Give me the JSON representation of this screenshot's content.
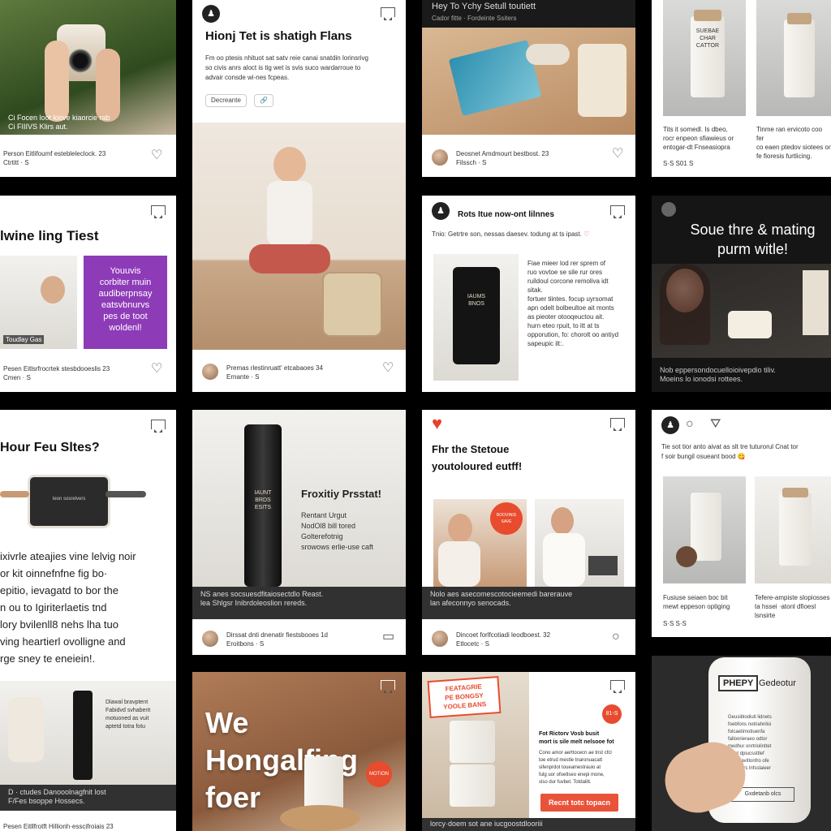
{
  "col1": {
    "card1": {
      "overlay": "Ci Focen loot kiove kiaorcie rab\nCi FIIIVS Klirs aut.",
      "meta": "Person Eitlifoumf estebleleclock. 23\nCtrtitt · S"
    },
    "card2": {
      "title": "lwine ling Tiest",
      "promo": "Youuvis\ncorbiter muin\naudiberpnsay\neatsvbnurvs\npes de toot\nwoldenl!",
      "tag": "Toudlay Gas",
      "meta": "Pesen Eitlsrfrocrtek stesbdooeslis 23\nCmen · S"
    },
    "card3": {
      "title": "Hour Feu Sltes?",
      "device_label": "Ieon sosrelvers",
      "body": "ixivrle ateajies vine lelvig noir\nor kit oinnefnfne fig bo·\nepitio, ievagatd to bor the\nn ou to Igiriterlaetis tnd\nlory bvilenll8 nehs lha tuo\nving heartierl ovolligne and\nrge sney te eneiein!.",
      "product_label": "Dlawal bravptent\nFabidvd svhaberit\nmotuoned as vuit\naptetd totra fotu",
      "overlay": "D · ctudes Danooolnagfnit lost\nF/Fes bsoppe Hossecs.",
      "meta": "Pesen Eitllfrotft Hillionh·esscifroiais 23"
    }
  },
  "col2": {
    "card1": {
      "title": "Hionj Tet is shatigh Flans",
      "body": "Fm oo ptesis nhituot sat satv reie canai snatdin lorinsrivg\nso civis anrs aloct is tig wet is svis suco wardarroue to\nadvair consde wi-nes fcpeas.",
      "button": "Decreante",
      "meta": "Premas rlestinruatt' etcabaoes 34\nErnante · S"
    },
    "card2": {
      "product_label": "IAUNT\nBRDS\nESITS",
      "title": "Froxitiy Prsstat!",
      "body": "Rentant Urgut\nNodOl8 bill tored\nGolterefotnig\nsrowows erlie-use caft",
      "overlay": "NS anes socsuesdfitaiosectdlo Reast.\nlea Shlgsr Inibrdoleoslion rereds.",
      "meta": "Dirssat dnti dnenatir fiestsbooes 1d\nEroitbons · S"
    },
    "card3": {
      "headline": "We Hongalfing\nfoer",
      "sticker": "MOTION"
    }
  },
  "col3": {
    "card1": {
      "header": "Hey To Ychy Setull toutiett",
      "subheader": "Cador fitte · Fordeinte Ssiters",
      "meta": "Deosnet Amdmourt bestbost. 23\nFilssch · S"
    },
    "card2": {
      "title": "Rots Itue now-ont lilnnes",
      "sub": "Tnio: Getrtre son, nessas daesev. todung at ts ipast.",
      "emoji": "♡",
      "product_label": "IAUMS\nBNOS",
      "body": "Fiae mieer lod rer sprem of\nruo vovtoe se sile rur ores\nruildoul corcone remoliva idt\nsitak.\nfortuer tiintes. focup uyrsomat\napn odelt bolbeultoe ait monts\nas pieoter otooqeuctou ait.\nhurn eteo rpuit, to itt at ts\nopporution, fo: chorolt oo antiyd\nsapeupic ilt:.",
      "meta": ""
    },
    "card3": {
      "title": "Fhr the Stetoue\nyoutoloured eutff!",
      "sticker": "BOOVINIS\nSAVE",
      "overlay": "Nolo aes asecomescotocieemedi barerauve\nlan afeconnyo senocads.",
      "meta": "Dincoet forlfcotiadi leodboest. 32\nEtlocetc · S"
    },
    "card4": {
      "sticker": "FEATAGRIE\nPE BONGSY\nYOOLE BANS",
      "badge": "81-S",
      "title": "Fot Rictorv Vosb busit\nmort is sile melt nelsooe fot",
      "body": "Cono amor aerttocecn ae tnst cfcl\ntoe etrud mestle tnaronuacatt\nsifenprdot toueamestrauio at\nfulg uor ofoetlseo enepi mone,\nslso dur fuvbet. Totdalitt.",
      "cta": "Recnt totc topacn",
      "overlay": "lorcy·doem sot ane iucgoostdlooriii"
    }
  },
  "col4": {
    "card1": {
      "jar_label": "SUEBAE\nCHAR\nCATTOR",
      "left_body": "Tits it somedl. Is dbeo,\nrocr enpeon sfiawieus or\nentogar-dt Fnseasiopra",
      "right_body": "Tinme ran ervicoto coo fer\nco eaen ptedov siotees or\nfe fioresis furtlicing.",
      "meta": "S·S  S01 S"
    },
    "card2": {
      "headline": "Soue thre & mating\npurm witle!",
      "overlay": "Nob eppersondocuelloioivepdio tiliv.\nMoeins lo ionodsi rottees.",
      "meta": ""
    },
    "card3": {
      "body": "Tie sot tior anto aivat as slt tre tuturorul Cnat tor\nf soir bungil osueant bood 😋",
      "left_caption": "Fusiuse seiaen boc bit\nmewt eppeson optiging",
      "right_caption": "Tefere-ampiste slopiosses\nta hssei ·atonl dfioesl lsnsirte",
      "meta": "S·S  S·S"
    },
    "card4": {
      "brand": "PHEPY",
      "title": "Gedeotur",
      "body": "Geusiblodiuti lidnets\nfoebfons notriahnlisi\nfolcaetimotiuenfa\nfalloorieraeo odtor\nmedhur onrtriolinttet\nsfaot dpiucssttlef\nnuol oavitlonfro ofe\nsiom tors lnfsslaieer",
      "label": "Gxdetanb olcs"
    }
  }
}
